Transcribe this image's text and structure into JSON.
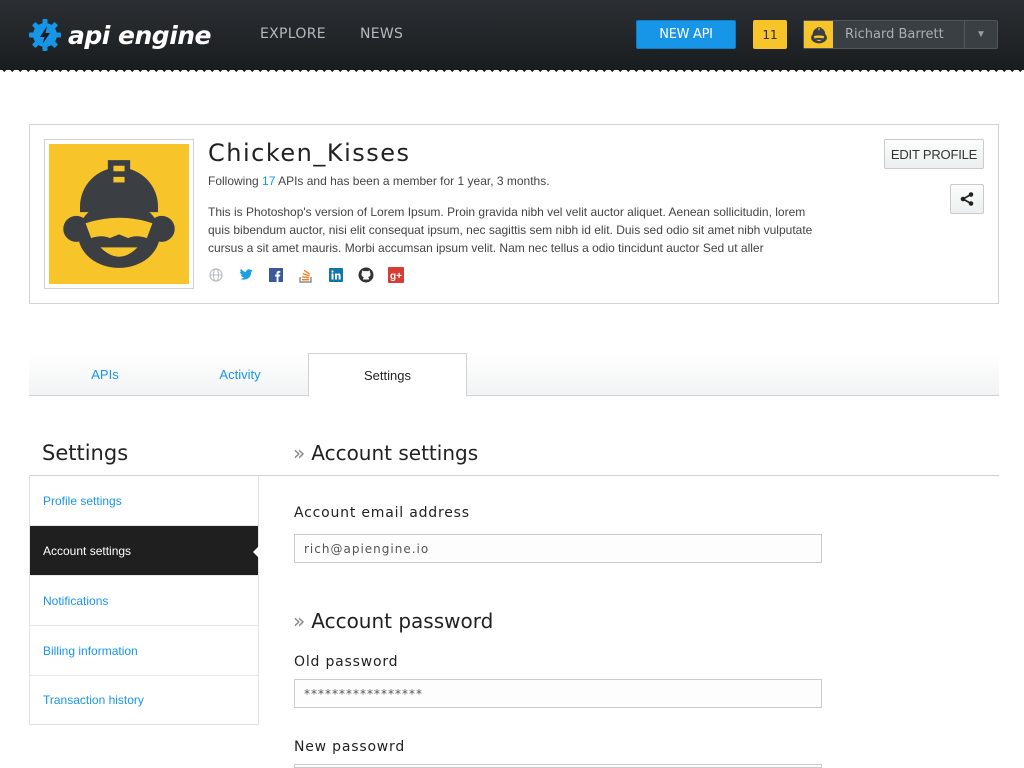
{
  "header": {
    "logo_text": "api engine",
    "nav": [
      {
        "label": "EXPLORE"
      },
      {
        "label": "NEWS"
      }
    ],
    "new_api_label": "NEW API",
    "notification_count": "11",
    "user_name": "Richard Barrett",
    "colors": {
      "accent": "#1795e6",
      "badge": "#f7c52a",
      "bar": "#1a1d20"
    }
  },
  "profile": {
    "username": "Chicken_Kisses",
    "following_prefix": "Following",
    "following_count": "17",
    "following_suffix": "APIs and has been a member for 1 year, 3 months.",
    "bio": "This is Photoshop's version  of Lorem Ipsum. Proin gravida nibh vel velit auctor aliquet. Aenean sollicitudin, lorem quis bibendum auctor, nisi elit consequat ipsum, nec sagittis sem nibh id elit. Duis sed odio sit amet nibh vulputate cursus a sit amet mauris. Morbi accumsan ipsum velit. Nam nec tellus a odio tincidunt auctor Sed ut aller",
    "social_icons": [
      "globe-icon",
      "twitter-icon",
      "facebook-icon",
      "stackoverflow-icon",
      "linkedin-icon",
      "github-icon",
      "googleplus-icon"
    ],
    "edit_label": "EDIT PROFILE"
  },
  "tabs": [
    {
      "label": "APIs",
      "active": false
    },
    {
      "label": "Activity",
      "active": false
    },
    {
      "label": "Settings",
      "active": true
    }
  ],
  "sidebar": {
    "heading": "Settings",
    "items": [
      {
        "label": "Profile settings",
        "active": false
      },
      {
        "label": "Account settings",
        "active": true
      },
      {
        "label": "Notifications",
        "active": false
      },
      {
        "label": "Billing information",
        "active": false
      },
      {
        "label": "Transaction history",
        "active": false
      }
    ]
  },
  "main": {
    "account_section": {
      "title": "Account settings",
      "email_label": "Account email address",
      "email_value": "rich@apiengine.io"
    },
    "password_section": {
      "title": "Account password",
      "old_label": "Old password",
      "old_value": "*****************",
      "new_label": "New passowrd"
    }
  }
}
